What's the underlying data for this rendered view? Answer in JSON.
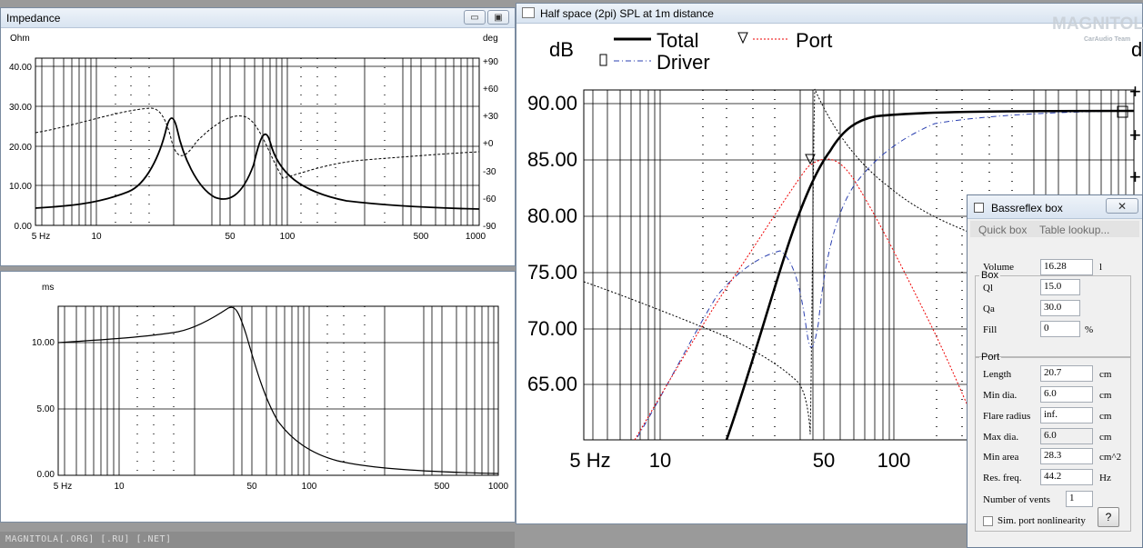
{
  "impedance": {
    "title": "Impedance",
    "y_left_label": "Ohm",
    "y_right_label": "deg",
    "y_left_ticks": [
      "0.00",
      "10.00",
      "20.00",
      "30.00",
      "40.00"
    ],
    "y_right_ticks": [
      "-90",
      "-60",
      "-30",
      "+0",
      "+30",
      "+60",
      "+90"
    ],
    "x_ticks": [
      "5 Hz",
      "10",
      "50",
      "100",
      "500",
      "1000"
    ]
  },
  "group_delay": {
    "y_label": "ms",
    "y_ticks": [
      "0.00",
      "5.00",
      "10.00"
    ],
    "x_ticks": [
      "5 Hz",
      "10",
      "50",
      "100",
      "500",
      "1000"
    ]
  },
  "spl": {
    "title": "Half space (2pi) SPL at 1m distance",
    "y_label": "dB",
    "y_ticks": [
      "65.00",
      "70.00",
      "75.00",
      "80.00",
      "85.00",
      "90.00"
    ],
    "x_ticks": [
      "5 Hz",
      "10",
      "50",
      "100"
    ],
    "legend": {
      "total": "Total",
      "port": "Port",
      "driver": "Driver"
    }
  },
  "dialog": {
    "title": "Bassreflex box",
    "close": "✕",
    "menu": {
      "quick_box": "Quick box",
      "table_lookup": "Table lookup..."
    },
    "box": {
      "legend": "Box",
      "volume_label": "Volume",
      "volume_value": "16.28",
      "volume_unit": "l",
      "ql_label": "Ql",
      "ql_value": "15.0",
      "qa_label": "Qa",
      "qa_value": "30.0",
      "fill_label": "Fill",
      "fill_value": "0",
      "fill_unit": "%"
    },
    "port": {
      "legend": "Port",
      "length_label": "Length",
      "length_value": "20.7",
      "length_unit": "cm",
      "mindia_label": "Min dia.",
      "mindia_value": "6.0",
      "mindia_unit": "cm",
      "flare_label": "Flare radius",
      "flare_value": "inf.",
      "flare_unit": "cm",
      "maxdia_label": "Max dia.",
      "maxdia_value": "6.0",
      "maxdia_unit": "cm",
      "minarea_label": "Min area",
      "minarea_value": "28.3",
      "minarea_unit": "cm^2",
      "resfreq_label": "Res. freq.",
      "resfreq_value": "44.2",
      "resfreq_unit": "Hz",
      "vents_label": "Number of vents",
      "vents_value": "1",
      "nonlin_label": "Sim. port nonlinearity",
      "help": "?"
    }
  },
  "status": {
    "text": "MAGNITOLA[.ORG] [.RU] [.NET]"
  },
  "watermark": {
    "brand": "MAGNITOLA",
    "team": "CarAudio Team"
  },
  "window_buttons": {
    "minimize": "▭",
    "maximize": "▣",
    "close": "✕"
  }
}
